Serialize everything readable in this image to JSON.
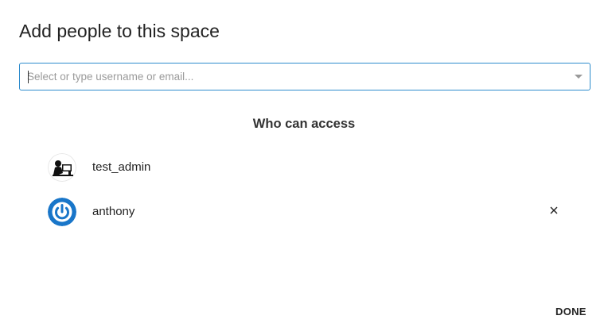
{
  "dialog": {
    "title": "Add people to this space",
    "search": {
      "placeholder": "Select or type username or email...",
      "value": ""
    },
    "access_heading": "Who can access",
    "people": [
      {
        "name": "test_admin",
        "avatar": "person-at-computer-avatar",
        "removable": false
      },
      {
        "name": "anthony",
        "avatar": "power-logo-avatar",
        "removable": true
      }
    ],
    "remove_glyph": "×",
    "done_label": "DONE"
  },
  "colors": {
    "focus_border": "#2d8ccd",
    "power_avatar_blue": "#1976c9"
  }
}
